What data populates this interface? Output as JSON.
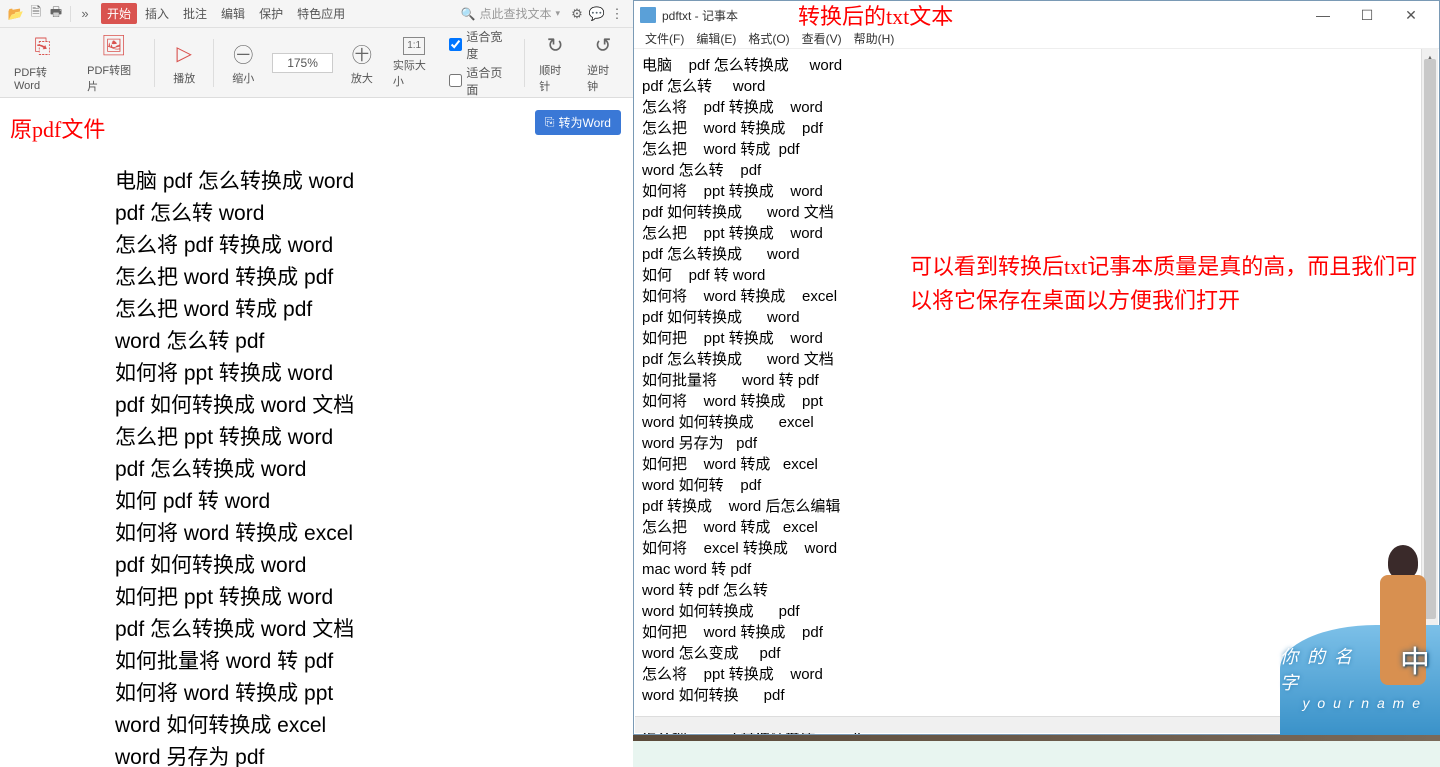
{
  "titlebar": {
    "tabs": [
      "开始",
      "插入",
      "批注",
      "编辑",
      "保护",
      "特色应用"
    ],
    "search_placeholder": "点此查找文本"
  },
  "ribbon": {
    "pdf_to_word": "PDF转Word",
    "pdf_to_img": "PDF转图片",
    "play": "播放",
    "shrink": "缩小",
    "zoom_value": "175%",
    "enlarge": "放大",
    "actual": "实际大小",
    "fit_width": "适合宽度",
    "fit_page": "适合页面",
    "clockwise": "顺时针",
    "anticlockwise": "逆时钟"
  },
  "annotations": {
    "left": "原pdf文件",
    "title": "转换后的txt文本",
    "right": "可以看到转换后txt记事本质量是真的高，而且我们可以将它保存在桌面以方便我们打开"
  },
  "convert_btn": "转为Word",
  "pdf_lines": [
    "电脑 pdf 怎么转换成 word",
    "pdf 怎么转 word",
    "怎么将 pdf 转换成 word",
    "怎么把 word 转换成 pdf",
    "怎么把 word 转成 pdf",
    "word 怎么转 pdf",
    "如何将 ppt 转换成 word",
    "pdf 如何转换成 word 文档",
    "怎么把 ppt 转换成 word",
    "pdf 怎么转换成 word",
    "如何 pdf 转 word",
    "如何将 word 转换成 excel",
    "pdf 如何转换成 word",
    "如何把 ppt 转换成 word",
    "pdf 怎么转换成 word 文档",
    "如何批量将 word 转 pdf",
    "如何将 word 转换成 ppt",
    "word 如何转换成 excel",
    "word 另存为 pdf"
  ],
  "notepad": {
    "title": "pdftxt - 记事本",
    "menus": [
      "文件(F)",
      "编辑(E)",
      "格式(O)",
      "查看(V)",
      "帮助(H)"
    ],
    "lines": [
      "电脑    pdf 怎么转换成     word",
      "pdf 怎么转     word",
      "怎么将    pdf 转换成    word",
      "怎么把    word 转换成    pdf",
      "怎么把    word 转成  pdf",
      "word 怎么转    pdf",
      "如何将    ppt 转换成    word",
      "pdf 如何转换成      word 文档",
      "怎么把    ppt 转换成    word",
      "pdf 怎么转换成      word",
      "如何    pdf 转 word",
      "如何将    word 转换成    excel",
      "pdf 如何转换成      word",
      "如何把    ppt 转换成    word",
      "pdf 怎么转换成      word 文档",
      "如何批量将      word 转 pdf",
      "如何将    word 转换成    ppt",
      "word 如何转换成      excel",
      "word 另存为   pdf",
      "如何把    word 转成   excel",
      "word 如何转    pdf",
      "pdf 转换成    word 后怎么编辑",
      "怎么把    word 转成   excel",
      "如何将    excel 转换成    word",
      "mac word 转 pdf",
      "word 转 pdf 怎么转",
      "word 如何转换成      pdf",
      "如何把    word 转换成    pdf",
      "word 怎么变成     pdf",
      "怎么将    ppt 转换成    word",
      "word 如何转换      pdf",
      "",
      "怎么把    word 文件转换成      pdf"
    ]
  },
  "decor": {
    "big": "中",
    "sub": "你 的 名 字",
    "rom": "y o u r   n a m e"
  }
}
